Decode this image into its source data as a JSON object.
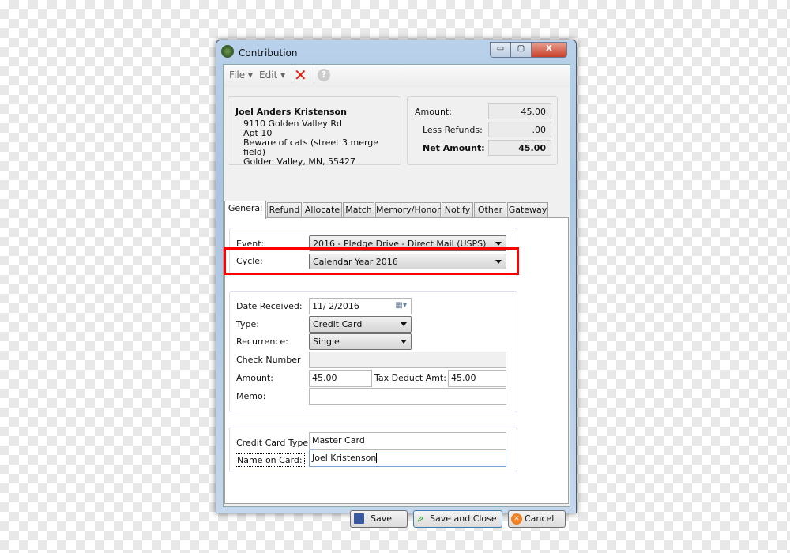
{
  "window": {
    "title": "Contribution",
    "minimize": "▭",
    "maximize": "▢",
    "close": "X"
  },
  "toolbar": {
    "file": "File",
    "edit": "Edit"
  },
  "donor": {
    "name": "Joel Anders Kristenson",
    "address": [
      "9110 Golden Valley Rd",
      "Apt 10",
      "Beware of cats (street 3 merge field)",
      "Golden Valley, MN, 55427"
    ]
  },
  "summary": {
    "amount_label": "Amount:",
    "amount": "45.00",
    "refunds_label": "Less Refunds:",
    "refunds": ".00",
    "net_label": "Net Amount:",
    "net": "45.00"
  },
  "tabs": [
    "General",
    "Refund",
    "Allocate",
    "Match",
    "Memory/Honor",
    "Notify",
    "Other",
    "Gateway"
  ],
  "active_tab": "General",
  "general": {
    "event_label": "Event:",
    "event": "2016 - Pledge Drive - Direct Mail (USPS)",
    "cycle_label": "Cycle:",
    "cycle": "Calendar Year 2016",
    "date_label": "Date Received:",
    "date": "11/  2/2016",
    "type_label": "Type:",
    "type": "Credit Card",
    "recurrence_label": "Recurrence:",
    "recurrence": "Single",
    "check_label": "Check Number",
    "check": "",
    "amount_label": "Amount:",
    "amount": "45.00",
    "tax_label": "Tax Deduct Amt:",
    "tax": "45.00",
    "memo_label": "Memo:",
    "memo": "",
    "cc_type_label": "Credit Card Type:",
    "cc_type": "Master Card",
    "name_label": "Name on Card:",
    "name": "Joel Kristenson"
  },
  "highlight_color": "#ff0000",
  "buttons": {
    "save": "Save",
    "save_close": "Save and Close",
    "cancel": "Cancel"
  }
}
